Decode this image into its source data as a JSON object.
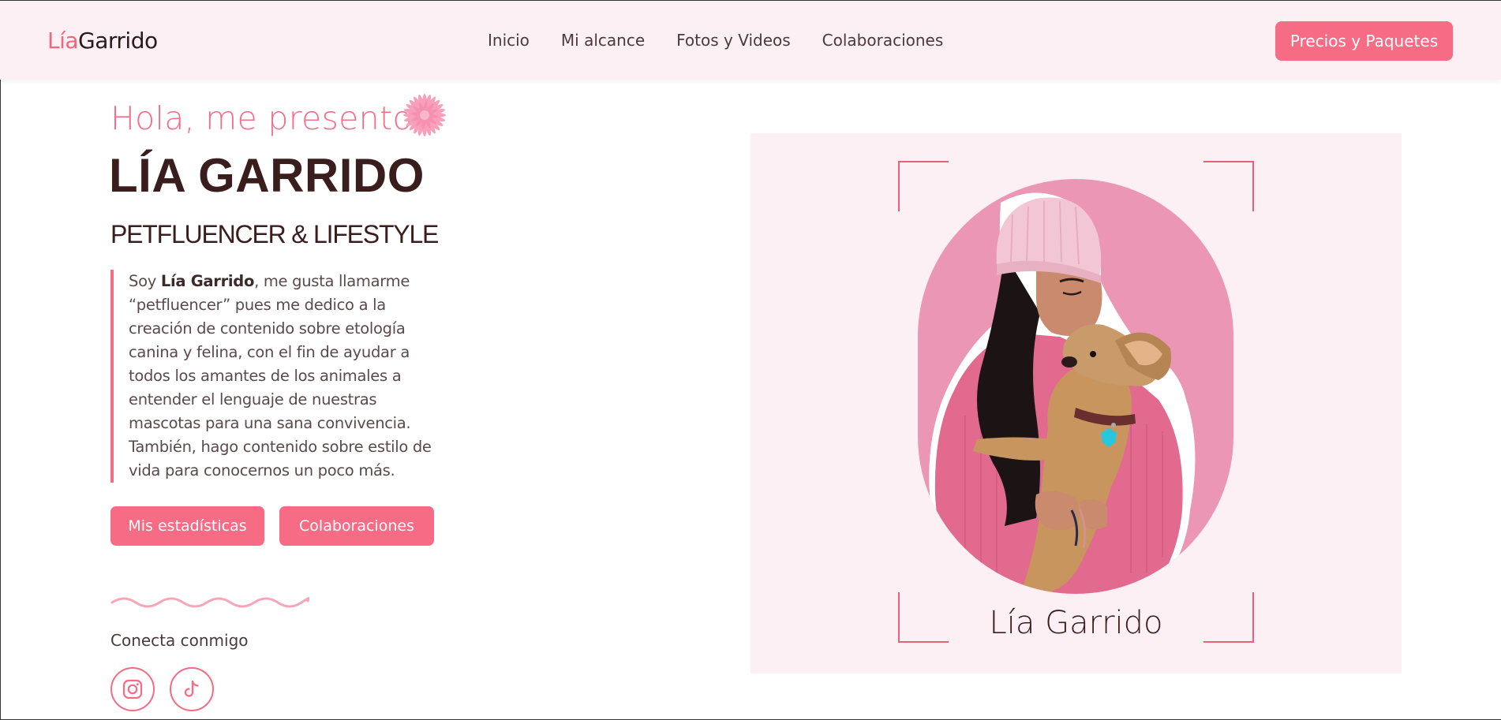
{
  "header": {
    "logo_first": "Lía",
    "logo_last": "Garrido",
    "nav": [
      "Inicio",
      "Mi alcance",
      "Fotos y Videos",
      "Colaboraciones"
    ],
    "cta_label": "Precios y Paquetes"
  },
  "hero": {
    "greeting": "Hola, me presento...",
    "name": "LÍA GARRIDO",
    "subtitle": "PETFLUENCER & LIFESTYLE",
    "bio_prefix": "Soy ",
    "bio_name": "Lía Garrido",
    "bio_text": ", me gusta llamarme “petfluencer” pues me dedico a la creación de contenido sobre etología canina y felina, con el fin de ayudar a todos los amantes de los animales a entender el lenguaje de nuestras mascotas para una sana convivencia. También, hago contenido sobre estilo de vida para conocernos un poco más.",
    "buttons": [
      "Mis estadísticas",
      "Colaboraciones"
    ],
    "connect_label": "Conecta conmigo",
    "social": [
      "instagram-icon",
      "tiktok-icon"
    ]
  },
  "card": {
    "caption": "Lía Garrido",
    "photo_icon": "woman-with-dog-photo"
  },
  "colors": {
    "accent": "#f56c84",
    "header_bg": "#fdf0f4",
    "heading": "#3a1d1d",
    "photo_bg": "#ec96b5"
  }
}
